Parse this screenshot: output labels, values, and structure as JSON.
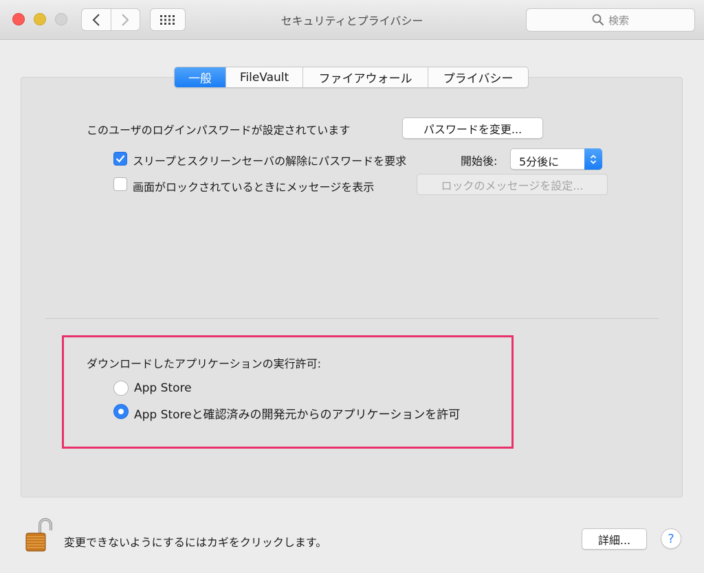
{
  "window": {
    "title": "セキュリティとプライバシー",
    "search_placeholder": "検索",
    "icons": {
      "back": "chevron-left-icon",
      "forward": "chevron-right-icon",
      "show_all": "grid-icon",
      "search": "search-icon"
    }
  },
  "tabs": [
    {
      "label": "一般",
      "active": true
    },
    {
      "label": "FileVault",
      "active": false
    },
    {
      "label": "ファイアウォール",
      "active": false
    },
    {
      "label": "プライバシー",
      "active": false
    }
  ],
  "general": {
    "login_password_text": "このユーザのログインパスワードが設定されています",
    "change_password_button": "パスワードを変更...",
    "require_password": {
      "label": "スリープとスクリーンセーバの解除にパスワードを要求",
      "checked": true,
      "start_label": "開始後:",
      "delay_value": "5分後に"
    },
    "show_message": {
      "label": "画面がロックされているときにメッセージを表示",
      "checked": false,
      "button": "ロックのメッセージを設定..."
    }
  },
  "downloads": {
    "heading": "ダウンロードしたアプリケーションの実行許可:",
    "options": [
      {
        "label": "App Store",
        "selected": false
      },
      {
        "label": "App Storeと確認済みの開発元からのアプリケーションを許可",
        "selected": true
      }
    ]
  },
  "footer": {
    "lock_text": "変更できないようにするにはカギをクリックします。",
    "advanced_button": "詳細...",
    "help_label": "?"
  },
  "colors": {
    "accent": "#2f83f7",
    "highlight": "#e8316a",
    "close": "#fc5b57",
    "minimize": "#e5bf3c"
  }
}
